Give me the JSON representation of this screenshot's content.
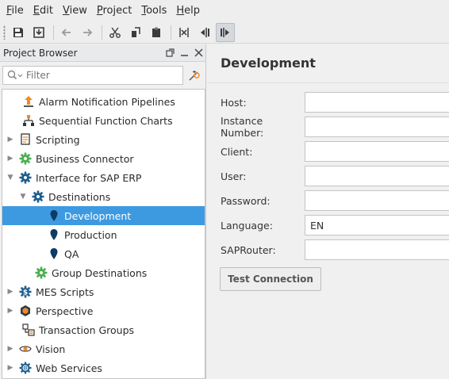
{
  "menu": [
    {
      "mnemonic": "F",
      "rest": "ile"
    },
    {
      "mnemonic": "E",
      "rest": "dit"
    },
    {
      "mnemonic": "V",
      "rest": "iew"
    },
    {
      "mnemonic": "P",
      "rest": "roject"
    },
    {
      "mnemonic": "T",
      "rest": "ools"
    },
    {
      "mnemonic": "H",
      "rest": "elp"
    }
  ],
  "toolbar": {
    "icons": [
      "save-icon",
      "save-all-icon",
      "undo-icon",
      "redo-icon",
      "cut-icon",
      "copy-icon",
      "paste-icon",
      "align-icon",
      "split-left-icon",
      "split-right-icon"
    ]
  },
  "project_browser": {
    "title": "Project Browser",
    "filter_placeholder": "Filter",
    "tree": [
      {
        "label": "Alarm Notification Pipelines",
        "icon": "alarm-pipeline-icon"
      },
      {
        "label": "Sequential Function Charts",
        "icon": "sfc-icon"
      },
      {
        "label": "Scripting",
        "icon": "scripting-icon"
      },
      {
        "label": "Business Connector",
        "icon": "gear-icon"
      },
      {
        "label": "Interface for SAP ERP",
        "icon": "gear-icon"
      },
      {
        "label": "Destinations",
        "icon": "gear-icon"
      },
      {
        "label": "Development",
        "icon": "destination-pin-icon"
      },
      {
        "label": "Production",
        "icon": "destination-pin-icon"
      },
      {
        "label": "QA",
        "icon": "destination-pin-icon"
      },
      {
        "label": "Group Destinations",
        "icon": "gear-icon"
      },
      {
        "label": "MES Scripts",
        "icon": "mes-scripts-icon"
      },
      {
        "label": "Perspective",
        "icon": "perspective-icon"
      },
      {
        "label": "Transaction Groups",
        "icon": "transaction-groups-icon"
      },
      {
        "label": "Vision",
        "icon": "vision-icon"
      },
      {
        "label": "Web Services",
        "icon": "web-services-icon"
      }
    ]
  },
  "editor": {
    "title": "Development",
    "fields": [
      {
        "label": "Host:",
        "value": ""
      },
      {
        "label": "Instance Number:",
        "value": ""
      },
      {
        "label": "Client:",
        "value": ""
      },
      {
        "label": "User:",
        "value": ""
      },
      {
        "label": "Password:",
        "value": ""
      },
      {
        "label": "Language:",
        "value": "EN"
      },
      {
        "label": "SAPRouter:",
        "value": ""
      }
    ],
    "test_button": "Test Connection"
  },
  "colors": {
    "selection": "#3e9ae0",
    "gear_green": "#4caf50",
    "gear_blue": "#1e5f8e"
  }
}
